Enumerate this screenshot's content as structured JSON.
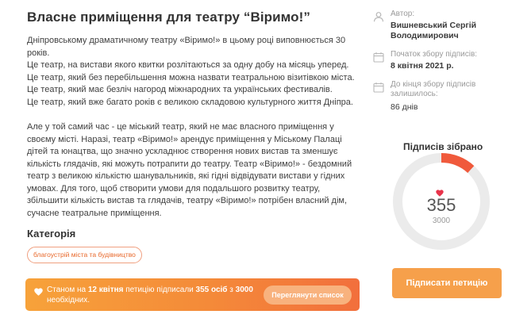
{
  "petition": {
    "title": "Власне приміщення для театру “Віримо!”",
    "description_paragraphs": [
      [
        "Дніпровському драматичному театру «Віримо!» в цьому році виповнюється 30 років.",
        "Це театр, на вистави якого квитки розлітаються за одну добу на місяць уперед.",
        "Це театр, який без перебільшення можна назвати театральною візитівкою міста.",
        "Це театр, який має безліч нагород міжнародних та українських фестивалів.",
        "Це театр, який вже багато років є великою складовою культурного життя Дніпра."
      ],
      [
        "Але у той самий час - це міський театр, який не має власного приміщення у своєму місті. Наразі, театр «Віримо!» арендує приміщення у Міському Палаці дітей та юнацтва, що значно ускладнює створення нових вистав та зменшує кількість глядачів, які можуть потрапити до театру. Театр «Віримо!» - бездомний театр з великою кількістю шанувальників, які гідні відвідувати вистави у гідних умовах. Для того, щоб створити умови для подальшого розвитку театру, збільшити кількість вистав та глядачів, театру «Віримо!» потрібен власний дім, сучасне театральне приміщення."
      ]
    ],
    "category_heading": "Категорія",
    "category_tag": "благоустрій міста та будівництво"
  },
  "banner": {
    "text_prefix": "Станом на ",
    "date": "12 квітня",
    "text_middle": " петицію підписали ",
    "count": "355 осіб",
    "text_join": " з ",
    "goal": "3000",
    "text_suffix": " необхідних.",
    "button_label": "Переглянути список"
  },
  "sidebar": {
    "author_label": "Автор:",
    "author_name_lines": [
      "Вишневський Сергій",
      "Володимирович"
    ],
    "start_label": "Початок збору підписів:",
    "start_value": "8 квітня 2021 р.",
    "remaining_label_lines": [
      "До кінця збору підписів",
      "залишилось:"
    ],
    "remaining_value": "86 днів",
    "signatures_title": "Підписів зібрано",
    "signatures_count": "355",
    "signatures_goal": "3000",
    "signatures_fraction": 0.1183,
    "sign_button_label": "Підписати петицію"
  },
  "colors": {
    "accent": "#f26f3c",
    "accent_light": "#f6a04b",
    "gauge_track": "#ebebeb",
    "gauge_fill": "#f05a3c",
    "heart": "#e8334a",
    "icon_gray": "#b8b8b8"
  },
  "icons": [
    "user-icon",
    "calendar-icon",
    "calendar-icon",
    "heart-icon"
  ]
}
